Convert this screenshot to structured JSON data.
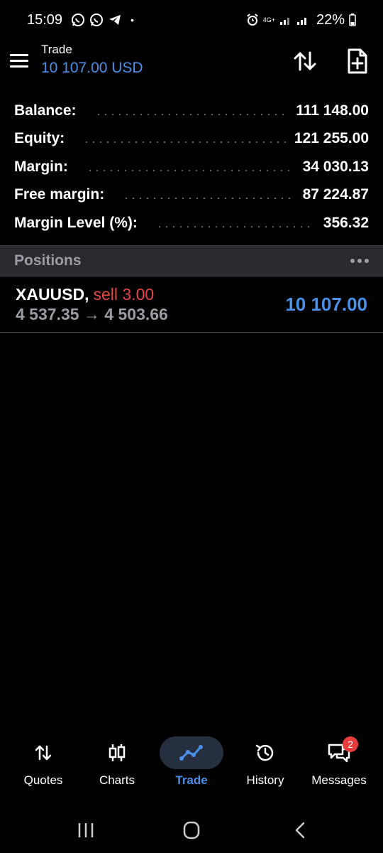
{
  "status_bar": {
    "time": "15:09",
    "dot": "•",
    "network_label": "4G+",
    "battery_pct": "22%"
  },
  "header": {
    "title": "Trade",
    "balance": "10 107.00 USD",
    "icons": [
      "menu-icon",
      "sort-icon",
      "new-order-icon"
    ]
  },
  "summary": [
    {
      "label": "Balance:",
      "value": "111 148.00"
    },
    {
      "label": "Equity:",
      "value": "121 255.00"
    },
    {
      "label": "Margin:",
      "value": "34 030.13"
    },
    {
      "label": "Free margin:",
      "value": "87 224.87"
    },
    {
      "label": "Margin Level (%):",
      "value": "356.32"
    }
  ],
  "positions": {
    "title": "Positions",
    "items": [
      {
        "symbol": "XAUUSD,",
        "side": "sell 3.00",
        "prices": "4 537.35 → 4 503.66",
        "profit": "10 107.00"
      }
    ]
  },
  "bottom_nav": [
    {
      "label": "Quotes",
      "icon": "quotes-icon"
    },
    {
      "label": "Charts",
      "icon": "charts-icon"
    },
    {
      "label": "Trade",
      "icon": "trade-icon",
      "active": true
    },
    {
      "label": "History",
      "icon": "history-icon"
    },
    {
      "label": "Messages",
      "icon": "messages-icon",
      "badge": "2"
    }
  ],
  "colors": {
    "accent_blue": "#4a90e8",
    "sell_red": "#e84545",
    "muted_gray": "#9a9da3",
    "background": "#000000",
    "section_bg": "#2a2b2e"
  }
}
